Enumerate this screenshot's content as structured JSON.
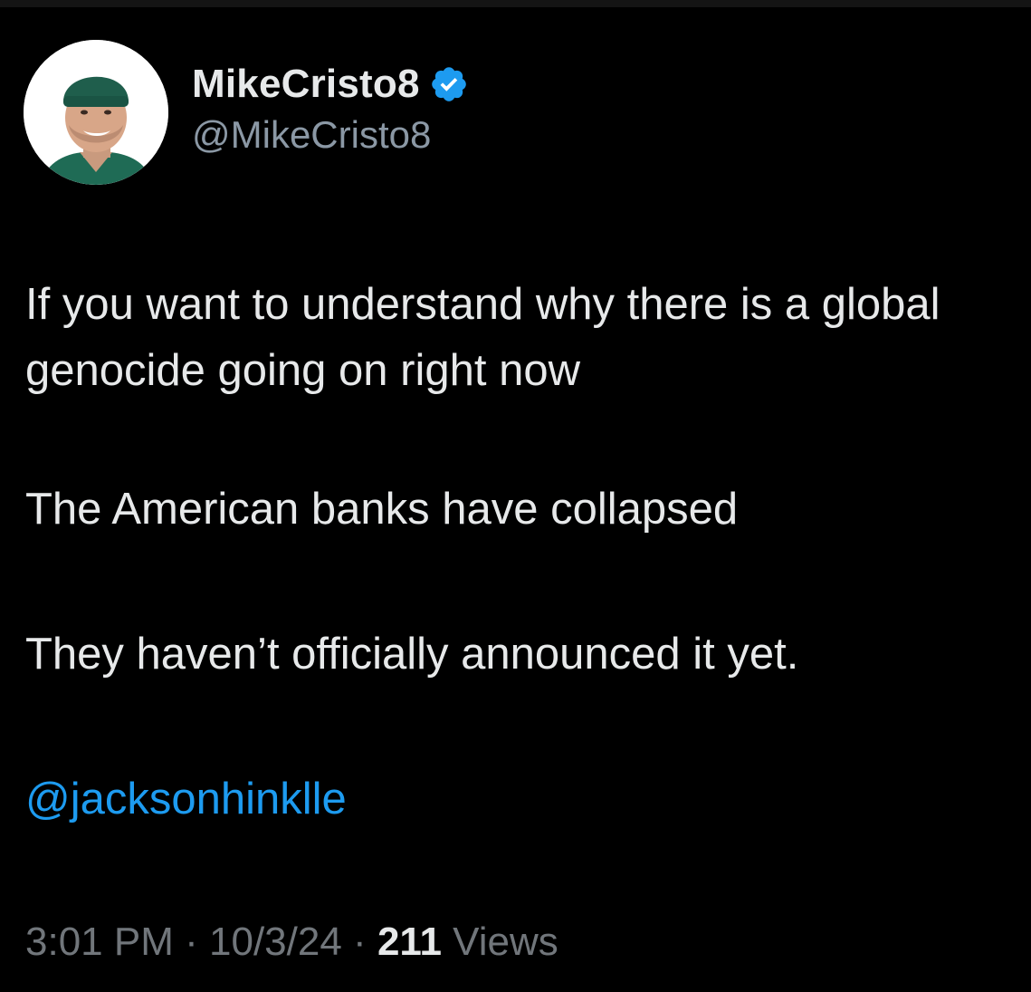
{
  "author": {
    "display_name": "MikeCristo8",
    "handle": "@MikeCristo8",
    "verified": true,
    "verified_color": "#1d9bf0",
    "avatar_icon": "profile-photo"
  },
  "tweet": {
    "paragraphs": [
      "If you want to understand why there is a global genocide going on right now",
      "The American banks have collapsed",
      "They haven’t officially announced it yet."
    ],
    "mention": "@jacksonhinklle"
  },
  "meta": {
    "time": "3:01 PM",
    "separator": "·",
    "date": "10/3/24",
    "views_count": "211",
    "views_label": "Views"
  },
  "colors": {
    "background": "#000000",
    "text": "#e7e9ea",
    "secondary_text": "#71767b",
    "link": "#1d9bf0"
  }
}
